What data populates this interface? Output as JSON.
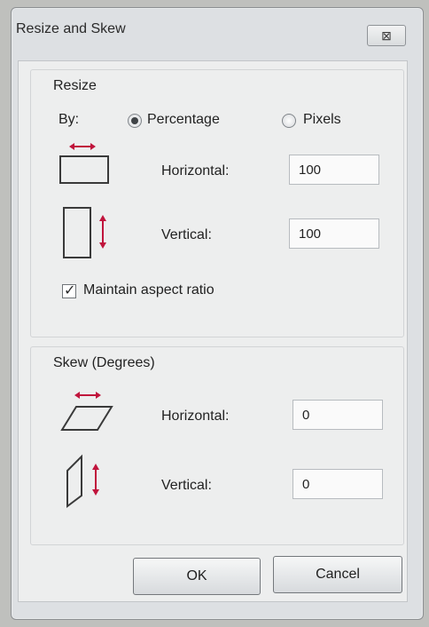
{
  "dialog": {
    "title": "Resize and Skew",
    "close_glyph": "⊠"
  },
  "resize": {
    "group_label": "Resize",
    "by_label": "By:",
    "option_percentage": "Percentage",
    "option_pixels": "Pixels",
    "selected": "Percentage",
    "horizontal_label": "Horizontal:",
    "horizontal_value": "100",
    "vertical_label": "Vertical:",
    "vertical_value": "100",
    "maintain_aspect_label": "Maintain aspect ratio",
    "maintain_aspect_checked": true
  },
  "skew": {
    "group_label": "Skew (Degrees)",
    "horizontal_label": "Horizontal:",
    "horizontal_value": "0",
    "vertical_label": "Vertical:",
    "vertical_value": "0"
  },
  "buttons": {
    "ok": "OK",
    "cancel": "Cancel"
  },
  "colors": {
    "arrow": "#c0143c",
    "window_bg": "#dde0e3",
    "client_bg": "#edeeee"
  },
  "icons": {
    "resize_horizontal": "resize-horizontal-icon",
    "resize_vertical": "resize-vertical-icon",
    "skew_horizontal": "skew-horizontal-icon",
    "skew_vertical": "skew-vertical-icon"
  }
}
